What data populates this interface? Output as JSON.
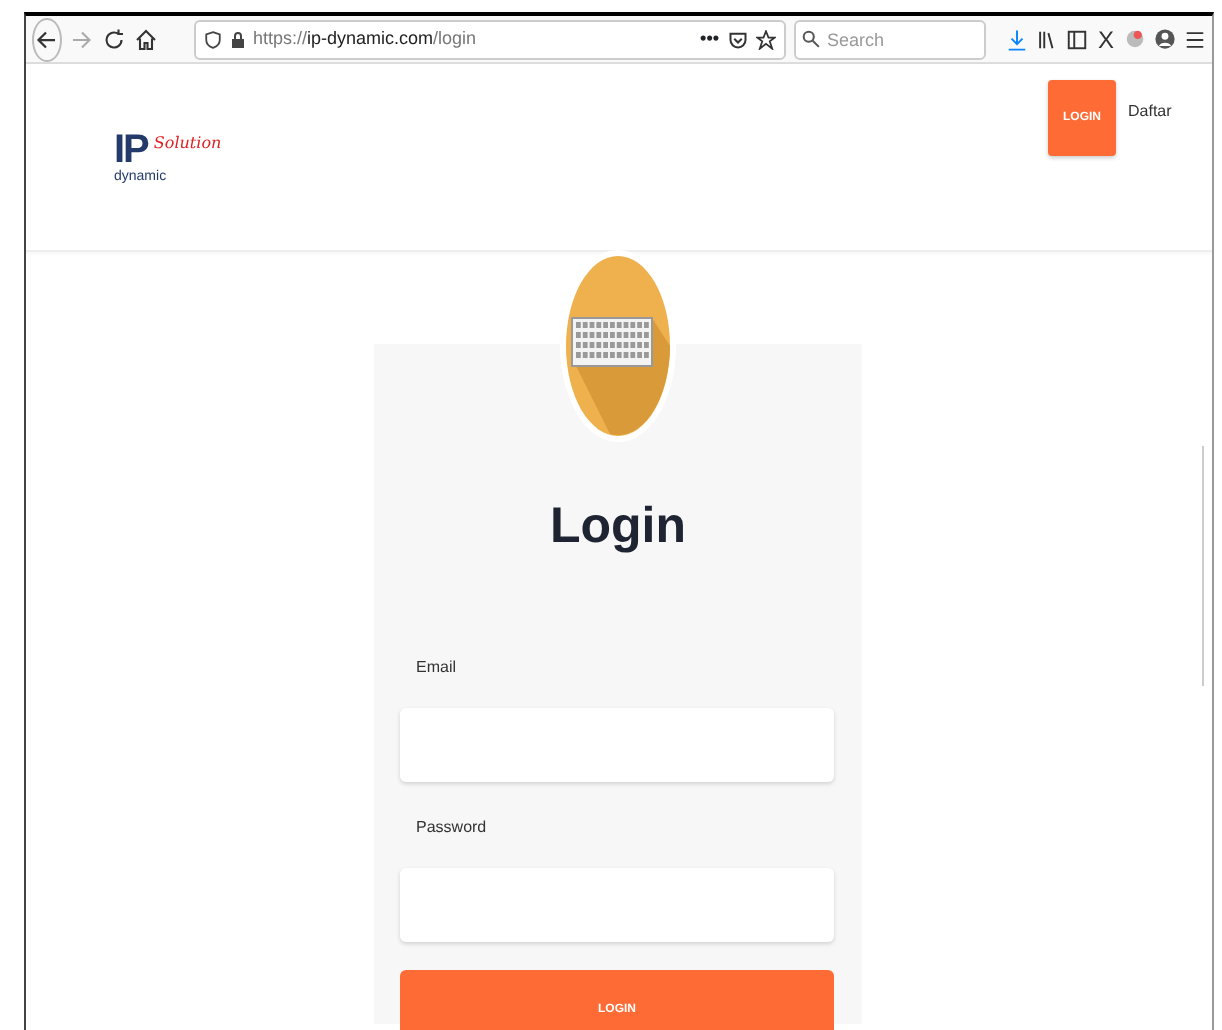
{
  "browser": {
    "url_prefix": "https://",
    "url_domain": "ip-dynamic.com",
    "url_path": "/login",
    "page_actions": "•••",
    "search": {
      "placeholder": "Search"
    },
    "extension_label": "X"
  },
  "header": {
    "logo": {
      "main": "IP",
      "script": "Solution",
      "sub": "dynamic"
    },
    "nav": [
      {
        "label": "LOGIN",
        "kind": "button"
      },
      {
        "label": "Daftar",
        "kind": "link"
      }
    ]
  },
  "login": {
    "title": "Login",
    "fields": [
      {
        "label": "Email"
      },
      {
        "label": "Password"
      }
    ],
    "submit": "LOGIN"
  }
}
